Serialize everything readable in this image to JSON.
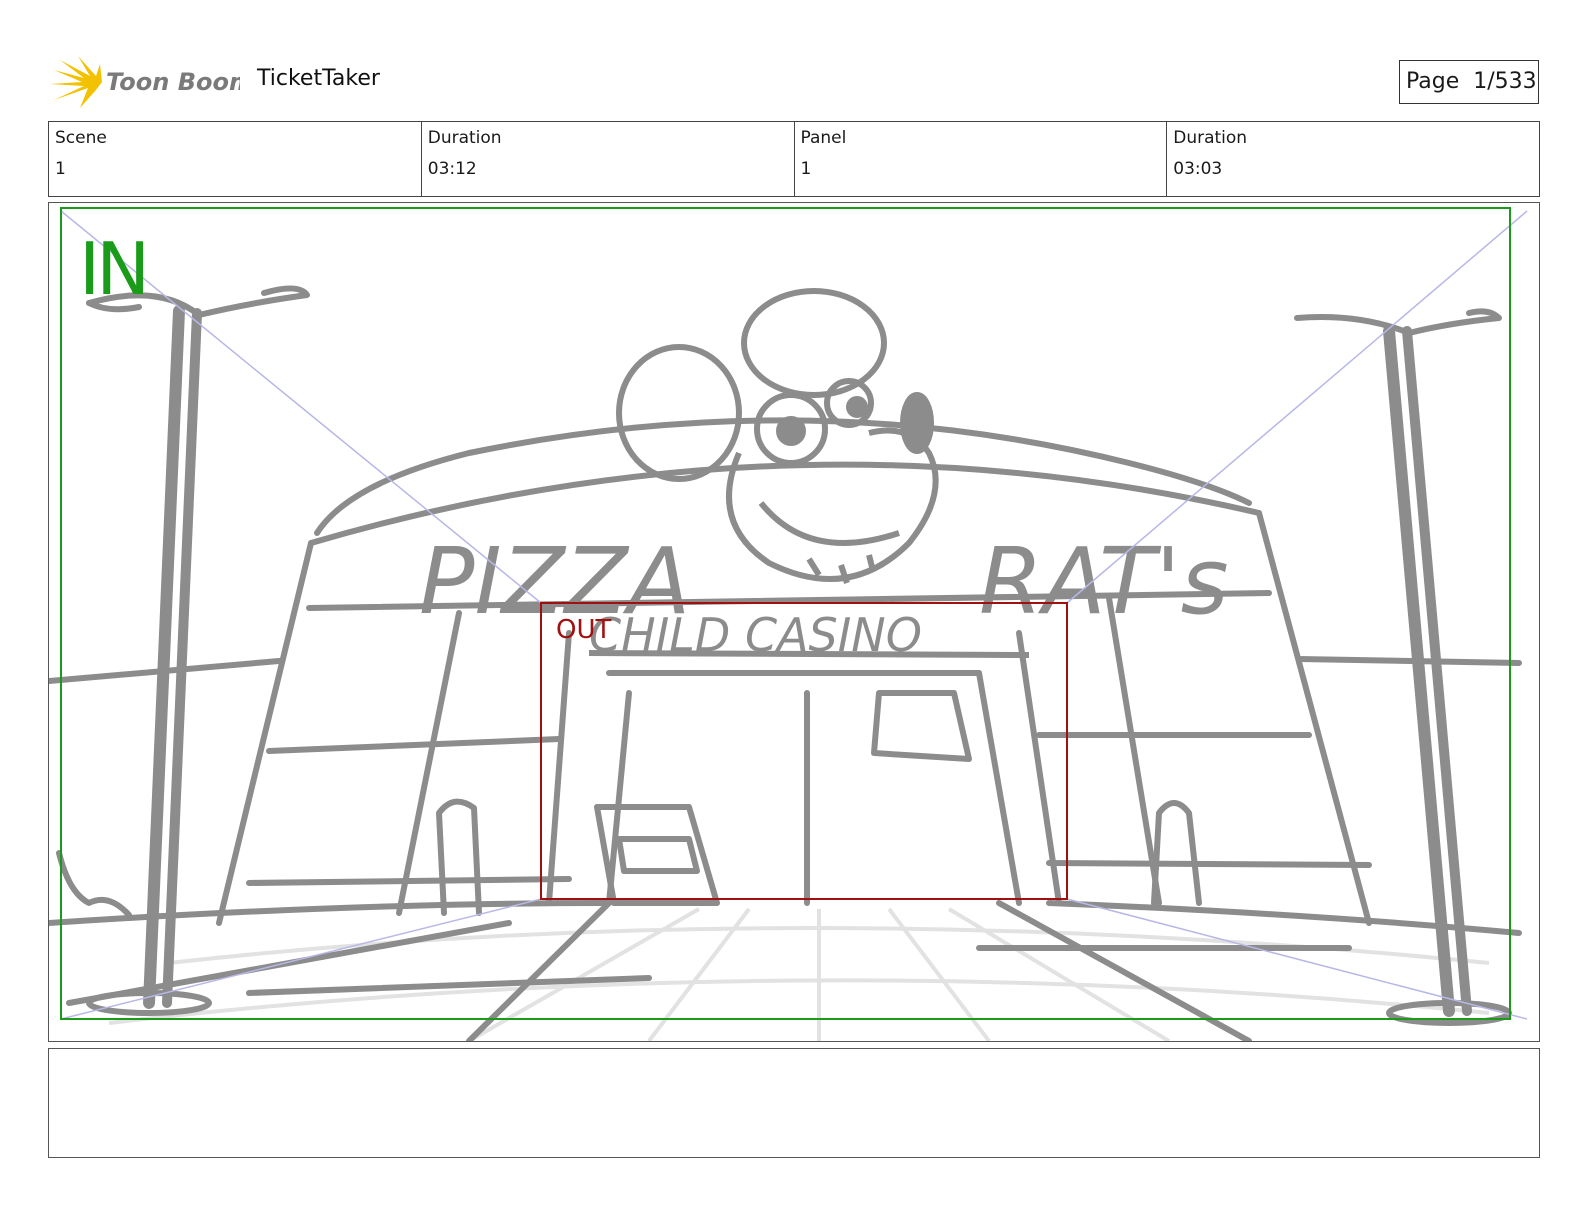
{
  "header": {
    "logo_text": "Toon Boom",
    "project_name": "TicketTaker",
    "page_label": "Page",
    "page_number": "1/533"
  },
  "info": {
    "scene_label": "Scene",
    "scene_value": "1",
    "scene_duration_label": "Duration",
    "scene_duration_value": "03:12",
    "panel_label": "Panel",
    "panel_value": "1",
    "panel_duration_label": "Duration",
    "panel_duration_value": "03:03"
  },
  "panel": {
    "in_label": "IN",
    "out_label": "OUT",
    "sign_text_1": "PIZZA",
    "sign_text_2": "RAT's",
    "sign_text_3": "CHILD CASINO"
  },
  "notes": {
    "text": ""
  },
  "colors": {
    "in_frame": "#1a9b1a",
    "out_frame": "#a01010",
    "sketch": "#8c8c8c",
    "logo_yellow": "#f2c200",
    "logo_gray": "#7a7a7a"
  }
}
